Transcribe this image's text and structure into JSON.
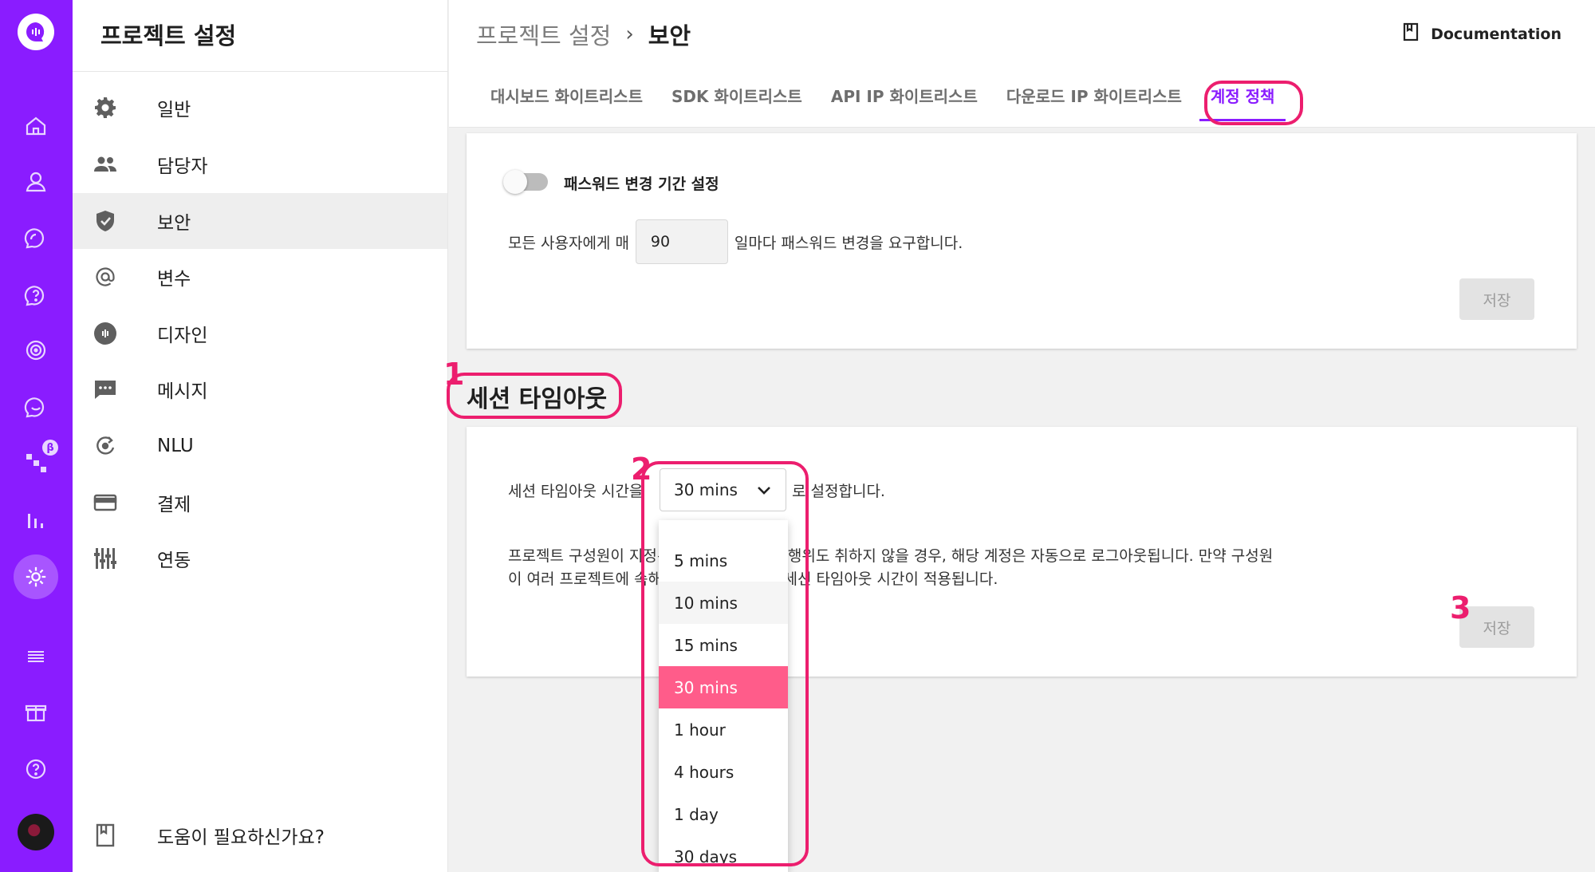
{
  "sidebar": {
    "title": "프로젝트 설정",
    "items": [
      {
        "label": "일반",
        "icon": "gear-icon"
      },
      {
        "label": "담당자",
        "icon": "people-icon"
      },
      {
        "label": "보안",
        "icon": "shield-icon"
      },
      {
        "label": "변수",
        "icon": "at-icon"
      },
      {
        "label": "디자인",
        "icon": "design-icon"
      },
      {
        "label": "메시지",
        "icon": "message-icon"
      },
      {
        "label": "NLU",
        "icon": "nlu-icon"
      },
      {
        "label": "결제",
        "icon": "card-icon"
      },
      {
        "label": "연동",
        "icon": "integration-icon"
      }
    ],
    "active_item": "보안",
    "help_label": "도움이 필요하신가요?"
  },
  "rail": {
    "beta_badge": "β",
    "icons": [
      "logo-icon",
      "home-icon",
      "user-icon",
      "chat-icon",
      "faq-icon",
      "target-icon",
      "search-chat-icon",
      "flow-icon",
      "stats-icon",
      "settings-icon",
      "list-icon",
      "gift-icon",
      "help-icon",
      "avatar"
    ]
  },
  "header": {
    "breadcrumb_parent": "프로젝트 설정",
    "breadcrumb_separator": "›",
    "breadcrumb_current": "보안",
    "documentation_label": "Documentation",
    "tabs": [
      {
        "label": "대시보드 화이트리스트"
      },
      {
        "label": "SDK 화이트리스트"
      },
      {
        "label": "API IP 화이트리스트"
      },
      {
        "label": "다운로드 IP 화이트리스트"
      },
      {
        "label": "계정 정책"
      }
    ],
    "active_tab": "계정 정책"
  },
  "password_card": {
    "toggle_label": "패스워드 변경 기간 설정",
    "toggle_on": false,
    "prefix": "모든 사용자에게 매",
    "days_value": "90",
    "suffix": "일마다 패스워드 변경을 요구합니다.",
    "save_label": "저장"
  },
  "session_section": {
    "title": "세션 타임아웃",
    "row_prefix": "세션 타임아웃 시간을",
    "selected_value": "30 mins",
    "row_suffix": "로 설정합니다.",
    "description": "프로젝트 구성원이 지정된 시간 동안 아무런 행위도 취하지 않을 경우, 해당 계정은 자동으로 로그아웃됩니다. 만약 구성원이 여러 프로젝트에 속해 있다면, 가장 짧은 세션 타임아웃 시간이 적용됩니다.",
    "save_label": "저장",
    "options": [
      "5 mins",
      "10 mins",
      "15 mins",
      "30 mins",
      "1 hour",
      "4 hours",
      "1 day",
      "30 days"
    ],
    "hovered_option": "10 mins"
  },
  "annotations": [
    "1",
    "2",
    "3"
  ],
  "colors": {
    "brand_purple": "#8a1cff",
    "selected_option": "#ff5c8a",
    "annotation": "#ec1e6e"
  }
}
